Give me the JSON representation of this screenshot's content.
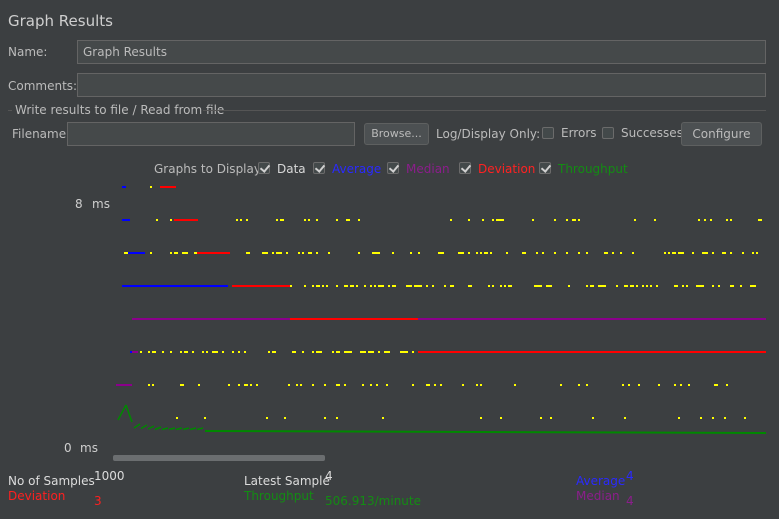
{
  "panel": {
    "title": "Graph Results",
    "name_label": "Name:",
    "name_value": "Graph Results",
    "comments_label": "Comments:",
    "comments_value": ""
  },
  "file_section": {
    "legend": "Write results to file / Read from file",
    "filename_label": "Filename",
    "filename_value": "",
    "browse_label": "Browse...",
    "log_display_label": "Log/Display Only:",
    "errors_label": "Errors",
    "errors_checked": false,
    "successes_label": "Successes",
    "successes_checked": false,
    "configure_label": "Configure"
  },
  "graphs": {
    "label": "Graphs to Display",
    "options": [
      {
        "label": "Data",
        "checked": true,
        "color": "#d8d8d8"
      },
      {
        "label": "Average",
        "checked": true,
        "color": "#2020ff"
      },
      {
        "label": "Median",
        "checked": true,
        "color": "#9b1e9b"
      },
      {
        "label": "Deviation",
        "checked": true,
        "color": "#ff2020"
      },
      {
        "label": "Throughput",
        "checked": true,
        "color": "#138c13"
      }
    ]
  },
  "axis": {
    "y_max": "8",
    "y_min": "0",
    "unit": "ms"
  },
  "chart_data": {
    "type": "scatter",
    "y_range": [
      0,
      8
    ],
    "y_unit": "ms",
    "sample_count": 1000,
    "series": [
      {
        "name": "Data",
        "color": "#ffff00"
      },
      {
        "name": "Average",
        "color": "#0000ff",
        "final_value": 4
      },
      {
        "name": "Median",
        "color": "#8b008b",
        "final_value": 4
      },
      {
        "name": "Deviation",
        "color": "#ff0000",
        "final_value": 3
      },
      {
        "name": "Throughput",
        "color": "#008800"
      }
    ]
  },
  "stats": {
    "no_of_samples_label": "No of Samples",
    "no_of_samples_value": "1000",
    "latest_sample_label": "Latest Sample",
    "latest_sample_value": "4",
    "average_label": "Average",
    "average_value": "4",
    "deviation_label": "Deviation",
    "deviation_value": "3",
    "throughput_label": "Throughput",
    "throughput_value": "506.913/minute",
    "median_label": "Median",
    "median_value": "4"
  }
}
